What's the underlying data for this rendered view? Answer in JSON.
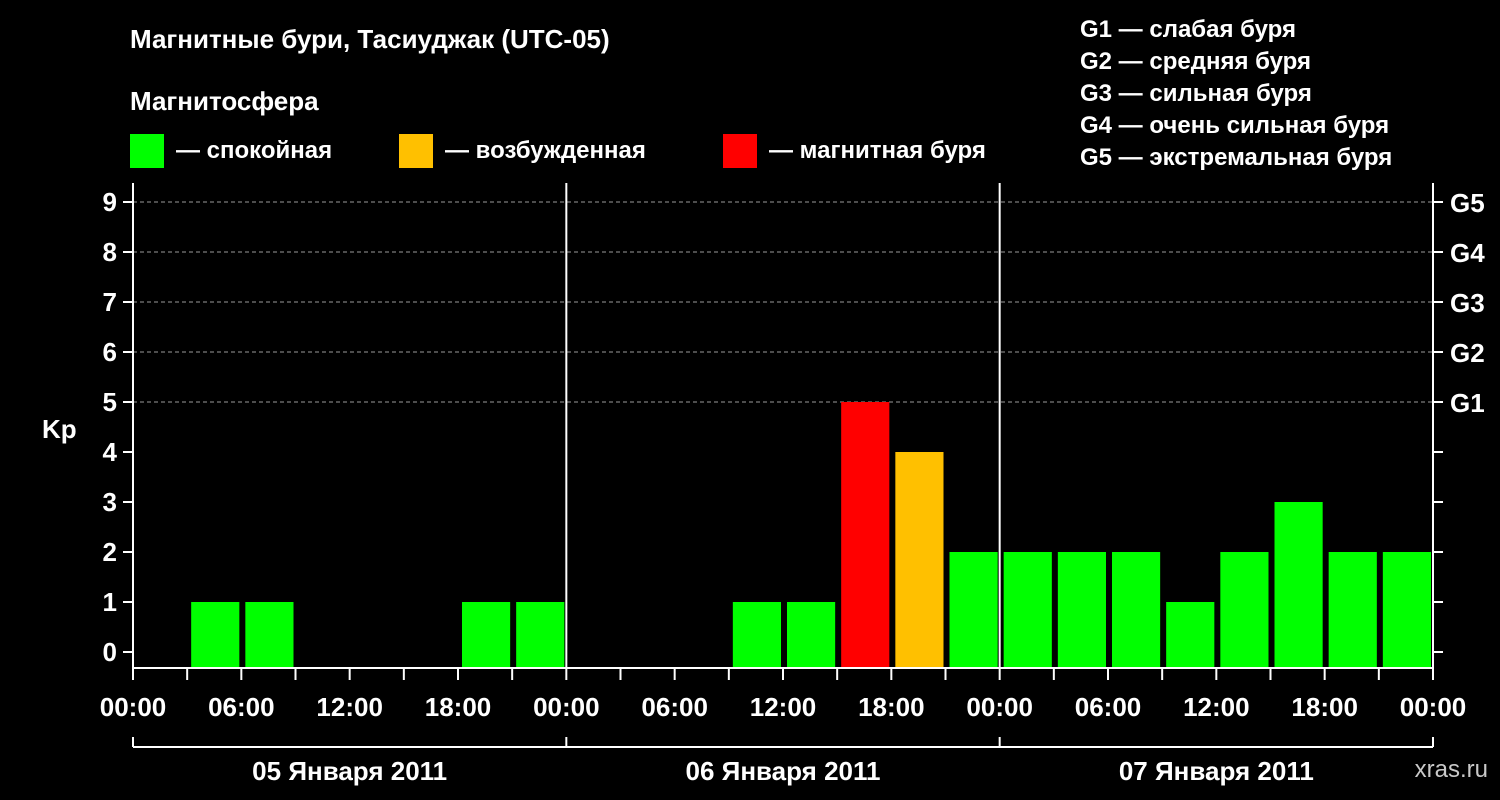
{
  "title": "Магнитные бури, Тасиуджак (UTC-05)",
  "subtitle": "Магнитосфера",
  "legend": [
    {
      "label": "— спокойная",
      "color": "#00ff00"
    },
    {
      "label": "— возбужденная",
      "color": "#ffc000"
    },
    {
      "label": "— магнитная буря",
      "color": "#ff0000"
    }
  ],
  "g_legend": [
    "G1 — слабая буря",
    "G2 — средняя буря",
    "G3 — сильная буря",
    "G4 — очень сильная буря",
    "G5 — экстремальная буря"
  ],
  "watermark": "xras.ru",
  "chart_data": {
    "type": "bar",
    "ylabel": "Kp",
    "ylim": [
      0,
      9
    ],
    "yticks": [
      "0",
      "1",
      "2",
      "3",
      "4",
      "5",
      "6",
      "7",
      "8",
      "9"
    ],
    "right_ticks": [
      {
        "value": 5,
        "label": "G1"
      },
      {
        "value": 6,
        "label": "G2"
      },
      {
        "value": 7,
        "label": "G3"
      },
      {
        "value": 8,
        "label": "G4"
      },
      {
        "value": 9,
        "label": "G5"
      }
    ],
    "xtick_labels": [
      "00:00",
      "06:00",
      "12:00",
      "18:00",
      "00:00",
      "06:00",
      "12:00",
      "18:00",
      "00:00",
      "06:00",
      "12:00",
      "18:00",
      "00:00"
    ],
    "days": [
      "05 Января 2011",
      "06 Января 2011",
      "07 Января 2011"
    ],
    "interval_hours": 3,
    "values": [
      0,
      1,
      1,
      0,
      0,
      0,
      1,
      1,
      0,
      0,
      0,
      1,
      1,
      5,
      4,
      2,
      2,
      2,
      2,
      1,
      2,
      3,
      2,
      2
    ],
    "grid": true,
    "colors": {
      "quiet": "#00ff00",
      "active": "#ffc000",
      "storm": "#ff0000"
    }
  }
}
